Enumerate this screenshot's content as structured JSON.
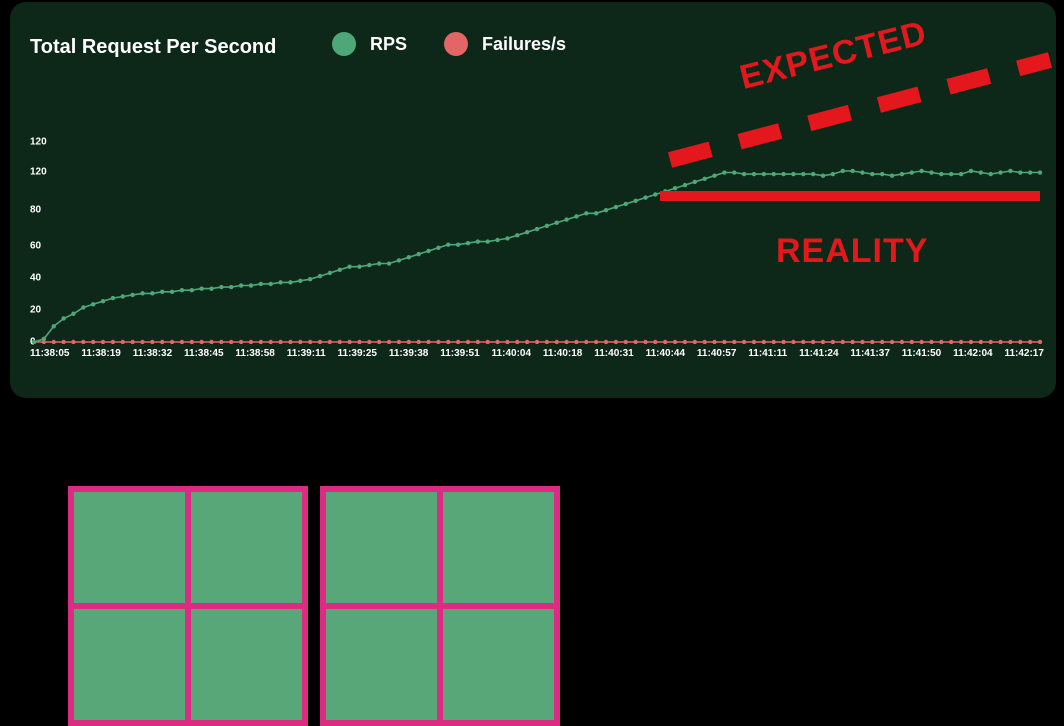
{
  "chart_data": {
    "type": "line",
    "title": "Total Request Per Second",
    "ylabel": "",
    "xlabel": "",
    "ylim": [
      0,
      120
    ],
    "y_ticks": [
      0,
      20,
      40,
      60,
      80,
      120,
      120
    ],
    "x_ticks": [
      "11:38:05",
      "11:38:19",
      "11:38:32",
      "11:38:45",
      "11:38:58",
      "11:39:11",
      "11:39:25",
      "11:39:38",
      "11:39:51",
      "11:40:04",
      "11:40:18",
      "11:40:31",
      "11:40:44",
      "11:40:57",
      "11:41:11",
      "11:41:24",
      "11:41:37",
      "11:41:50",
      "11:42:04",
      "11:42:17"
    ],
    "series": [
      {
        "name": "RPS",
        "color": "#4ea779",
        "values": [
          0,
          2,
          10,
          15,
          18,
          22,
          24,
          26,
          28,
          29,
          30,
          31,
          31,
          32,
          32,
          33,
          33,
          34,
          34,
          35,
          35,
          36,
          36,
          37,
          37,
          38,
          38,
          39,
          40,
          42,
          44,
          46,
          48,
          48,
          49,
          50,
          50,
          52,
          54,
          56,
          58,
          60,
          62,
          62,
          63,
          64,
          64,
          65,
          66,
          68,
          70,
          72,
          74,
          76,
          78,
          80,
          82,
          82,
          84,
          86,
          88,
          90,
          92,
          94,
          96,
          98,
          100,
          102,
          104,
          106,
          108,
          108,
          107,
          107,
          107,
          107,
          107,
          107,
          107,
          107,
          106,
          107,
          109,
          109,
          108,
          107,
          107,
          106,
          107,
          108,
          109,
          108,
          107,
          107,
          107,
          109,
          108,
          107,
          108,
          109,
          108,
          108,
          108
        ]
      },
      {
        "name": "Failures/s",
        "color": "#e36666",
        "values": [
          0,
          0,
          0,
          0,
          0,
          0,
          0,
          0,
          0,
          0,
          0,
          0,
          0,
          0,
          0,
          0,
          0,
          0,
          0,
          0,
          0,
          0,
          0,
          0,
          0,
          0,
          0,
          0,
          0,
          0,
          0,
          0,
          0,
          0,
          0,
          0,
          0,
          0,
          0,
          0,
          0,
          0,
          0,
          0,
          0,
          0,
          0,
          0,
          0,
          0,
          0,
          0,
          0,
          0,
          0,
          0,
          0,
          0,
          0,
          0,
          0,
          0,
          0,
          0,
          0,
          0,
          0,
          0,
          0,
          0,
          0,
          0,
          0,
          0,
          0,
          0,
          0,
          0,
          0,
          0,
          0,
          0,
          0,
          0,
          0,
          0,
          0,
          0,
          0,
          0,
          0,
          0,
          0,
          0,
          0,
          0,
          0,
          0,
          0,
          0,
          0,
          0,
          0
        ]
      }
    ],
    "annotations": {
      "expected_label": "EXPECTED",
      "reality_label": "REALITY"
    }
  },
  "colors": {
    "panel_bg": "#0d2818",
    "rps": "#4ea779",
    "failures": "#e36666",
    "annotation": "#e4171d",
    "server_border": "#dd2a82",
    "server_core": "#57a778"
  }
}
